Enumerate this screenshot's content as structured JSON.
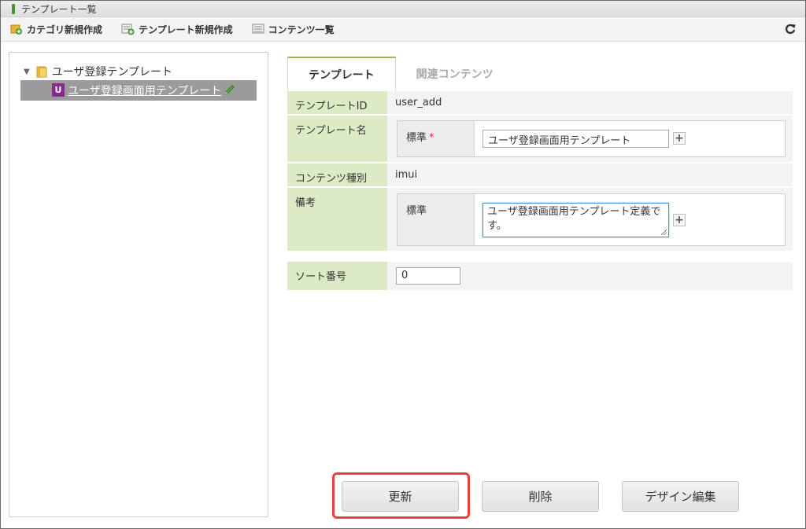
{
  "window": {
    "title": "テンプレート一覧"
  },
  "toolbar": {
    "category_new": "カテゴリ新規作成",
    "template_new": "テンプレート新規作成",
    "content_list": "コンテンツ一覧"
  },
  "tree": {
    "root_label": "ユーザ登録テンプレート",
    "child_badge": "U",
    "child_label": "ユーザ登録画面用テンプレート"
  },
  "tabs": {
    "template": "テンプレート",
    "related": "関連コンテンツ"
  },
  "form": {
    "template_id_label": "テンプレートID",
    "template_id_value": "user_add",
    "template_name_label": "テンプレート名",
    "locale_standard": "標準",
    "required_mark": "*",
    "template_name_value": "ユーザ登録画面用テンプレート",
    "content_type_label": "コンテンツ種別",
    "content_type_value": "imui",
    "note_label": "備考",
    "note_value": "ユーザ登録画面用テンプレート定義です。",
    "sort_label": "ソート番号",
    "sort_value": "0",
    "plus": "+"
  },
  "buttons": {
    "update": "更新",
    "delete": "削除",
    "design_edit": "デザイン編集"
  },
  "colors": {
    "label_bg": "#dcebc6",
    "tab_accent": "#9ab84f",
    "highlight": "#e8413c",
    "tree_selected": "#9b9b9b",
    "badge": "#8a2a8f"
  }
}
